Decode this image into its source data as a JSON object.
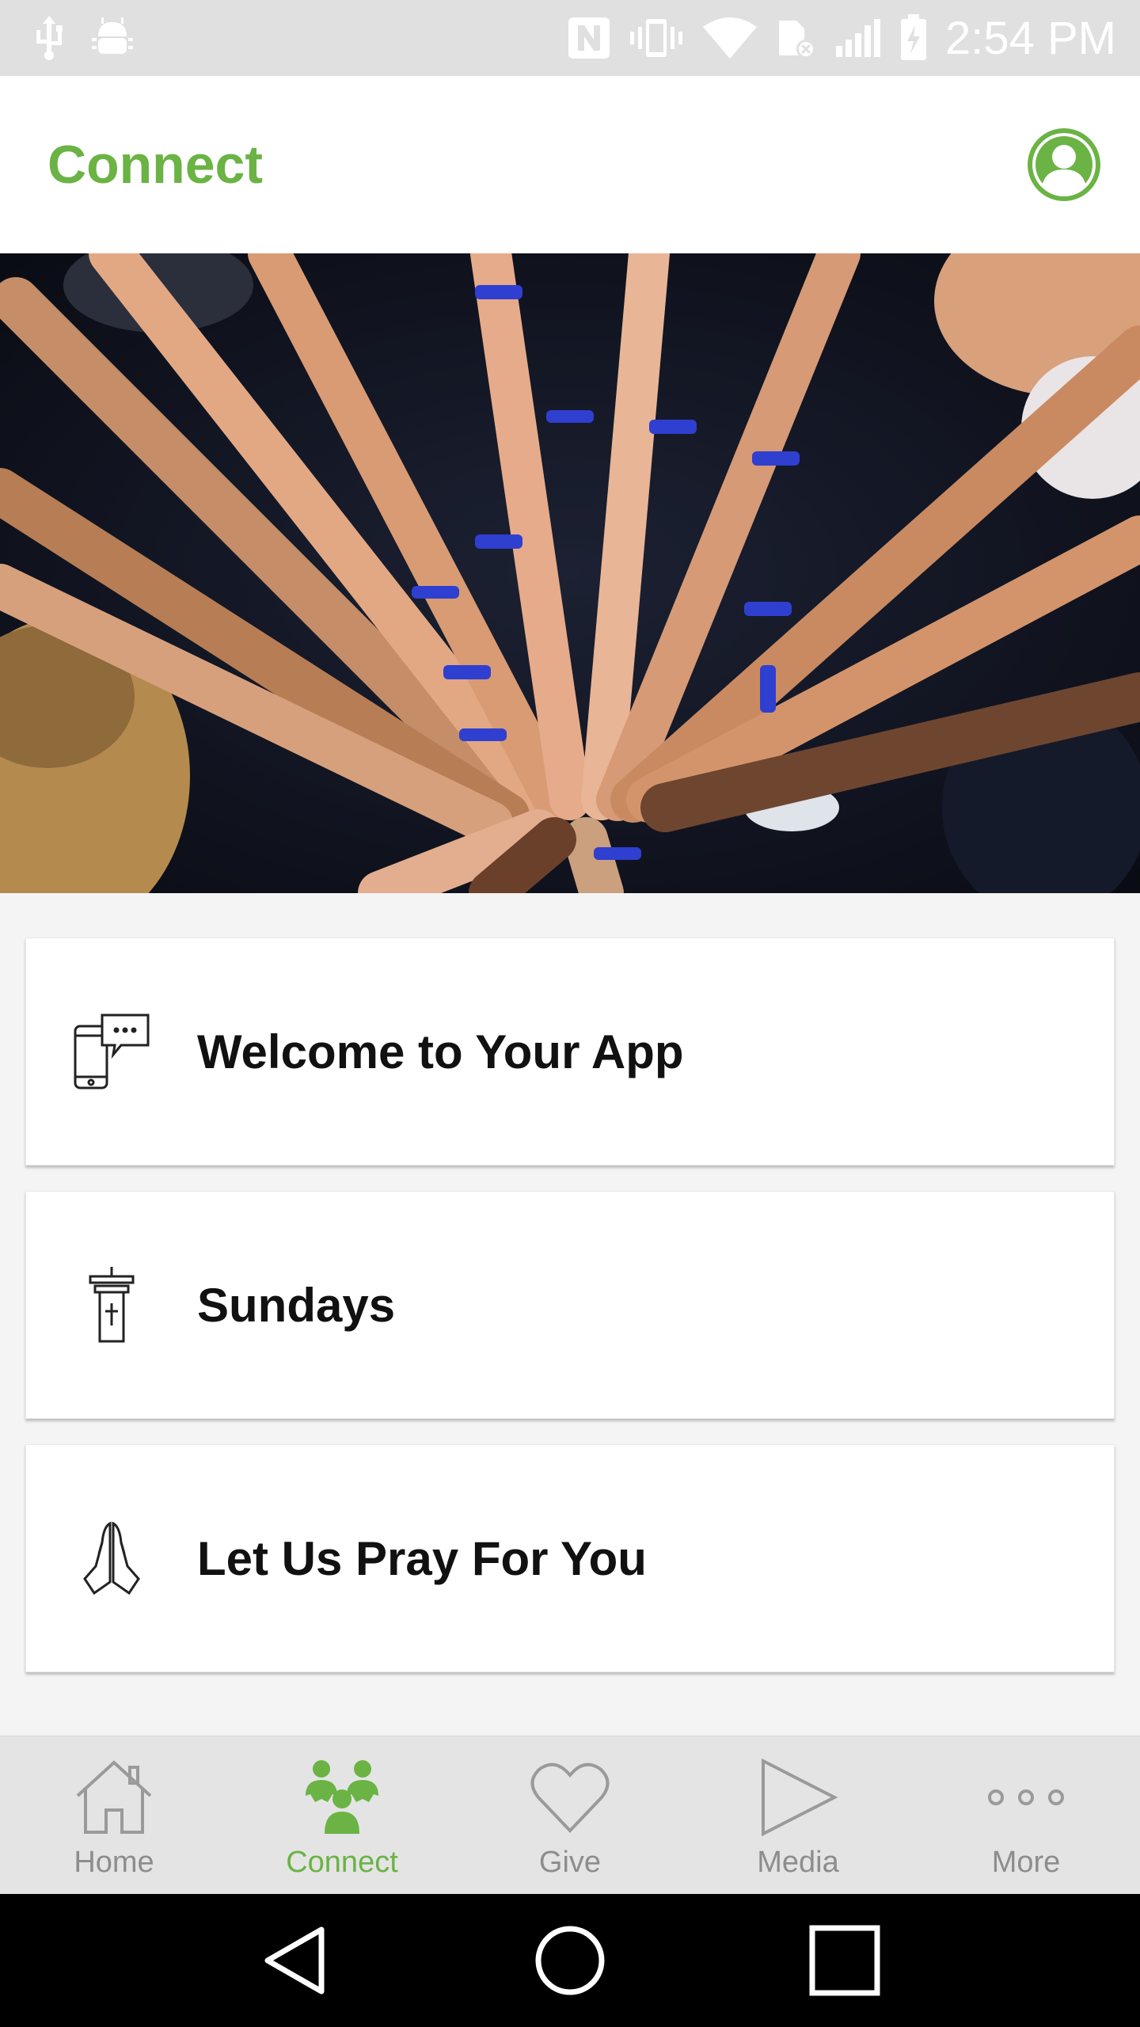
{
  "status_bar": {
    "time": "2:54 PM",
    "icons": [
      "usb-icon",
      "android-debug-icon",
      "nfc-icon",
      "vibrate-icon",
      "wifi-icon",
      "sim-icon",
      "signal-icon",
      "battery-charging-icon"
    ]
  },
  "app_bar": {
    "title": "Connect",
    "avatar_icon": "user-avatar-icon"
  },
  "hero": {
    "image_description": "photo-of-hands-joined-together"
  },
  "cards": [
    {
      "label": "Welcome to Your App",
      "icon": "phone-chat-icon"
    },
    {
      "label": "Sundays",
      "icon": "pulpit-icon"
    },
    {
      "label": "Let Us Pray For You",
      "icon": "praying-hands-icon"
    }
  ],
  "bottom_nav": {
    "items": [
      {
        "label": "Home",
        "icon": "home-icon",
        "active": false
      },
      {
        "label": "Connect",
        "icon": "group-icon",
        "active": true
      },
      {
        "label": "Give",
        "icon": "heart-icon",
        "active": false
      },
      {
        "label": "Media",
        "icon": "play-icon",
        "active": false
      },
      {
        "label": "More",
        "icon": "more-dots-icon",
        "active": false
      }
    ]
  },
  "colors": {
    "accent": "#6ab344",
    "nav_inactive": "#8d8d8d",
    "status_bar": "#e0e0e0"
  }
}
